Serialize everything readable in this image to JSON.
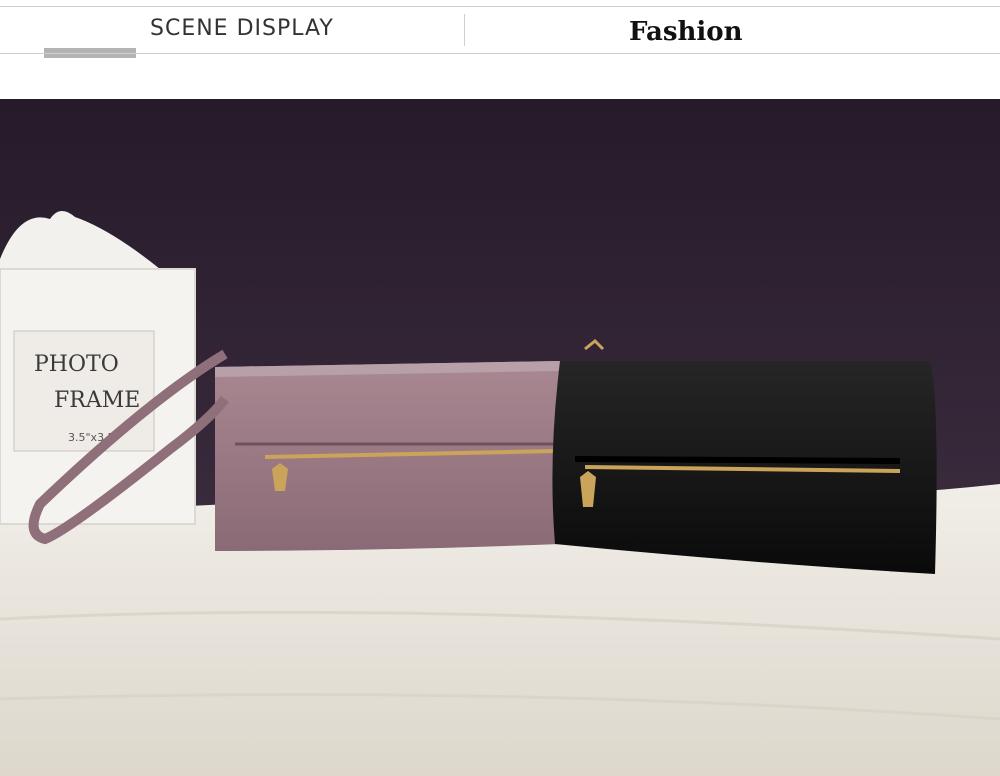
{
  "header": {
    "section_label": "SCENE DISPLAY",
    "section_title": "Fashion"
  },
  "photo": {
    "frame_text_line1": "PHOTO",
    "frame_text_line2": "FRAME",
    "frame_size_text": "3.5\"x3.5\""
  },
  "colors": {
    "background_wall": "#2b1f2e",
    "fabric": "#e8e4dc",
    "pink_wallet": "#9b7a84",
    "black_wallet": "#141414",
    "zipper_gold": "#c9a45a"
  }
}
